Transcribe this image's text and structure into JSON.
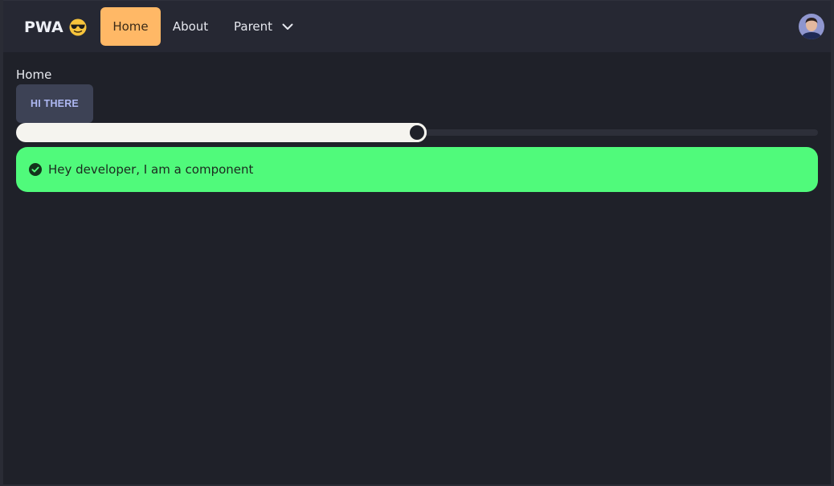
{
  "navbar": {
    "brand": "PWA",
    "brand_icon": "sunglasses-emoji-icon",
    "items": [
      {
        "label": "Home",
        "active": true
      },
      {
        "label": "About",
        "active": false
      },
      {
        "label": "Parent",
        "active": false,
        "icon": "chevron-down-icon"
      }
    ],
    "avatar_icon": "user-avatar"
  },
  "main": {
    "page_title": "Home",
    "button_label": "HI THERE",
    "range": {
      "min": 0,
      "max": 100,
      "value": 50
    },
    "alert": {
      "icon": "check-circle-icon",
      "text": "Hey developer, I am a component"
    }
  },
  "colors": {
    "background": "#1f2129",
    "navbar": "#262833",
    "active_nav": "#ffb866",
    "button": "#3d4255",
    "button_text": "#aeb8f2",
    "range_fill": "#f5f4ef",
    "alert_success": "#50fa7b"
  }
}
